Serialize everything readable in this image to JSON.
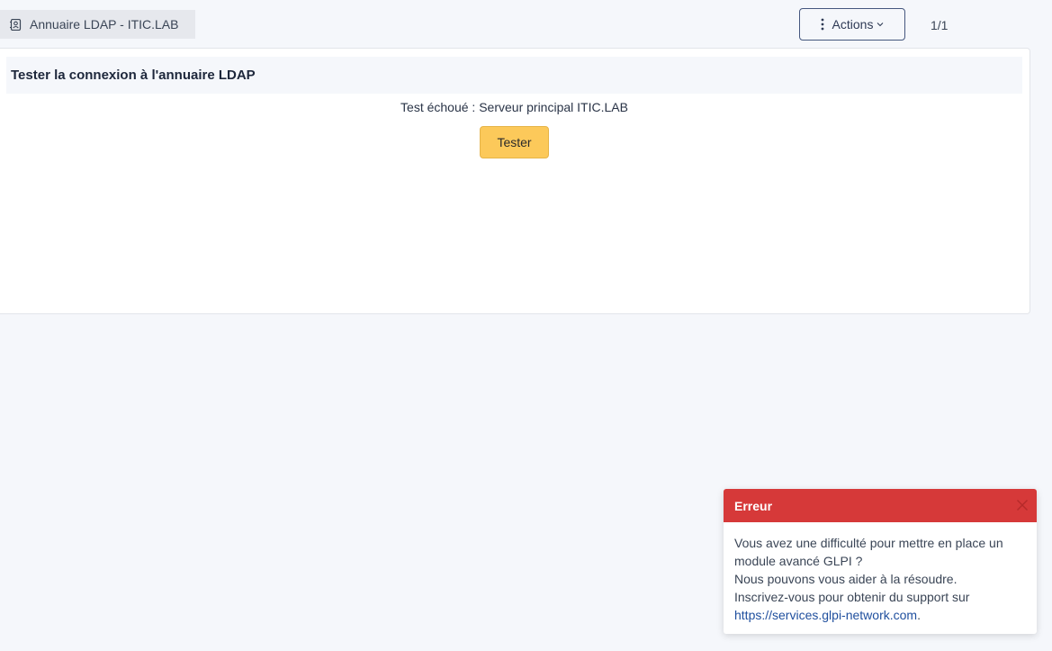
{
  "header": {
    "tab_label": "Annuaire LDAP - ITIC.LAB",
    "tab_icon": "address-book-icon",
    "actions_label": "Actions",
    "pager": "1/1"
  },
  "card": {
    "title": "Tester la connexion à l'annuaire LDAP",
    "result_text": "Test échoué : Serveur principal ITIC.LAB",
    "tester_label": "Tester"
  },
  "toast": {
    "title": "Erreur",
    "line1": "Vous avez une difficulté pour mettre en place un",
    "line2": "module avancé GLPI ?",
    "line3": "Nous pouvons vous aider à la résoudre.",
    "line4": "Inscrivez-vous pour obtenir du support sur",
    "link": "https://services.glpi-network.com",
    "link_suffix": "."
  },
  "colors": {
    "background": "#f5f7fb",
    "warning_button": "#fcc95a",
    "error_header": "#d63939",
    "link": "#1f4f9e"
  }
}
